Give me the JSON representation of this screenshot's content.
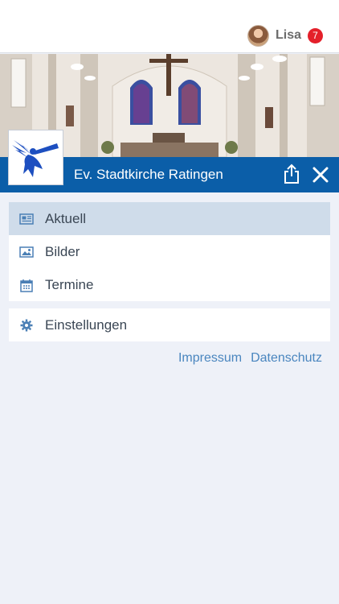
{
  "user": {
    "name": "Lisa",
    "notification_count": "7"
  },
  "header": {
    "title": "Ev. Stadtkirche Ratingen",
    "share_icon": "share-icon",
    "close_icon": "close-icon"
  },
  "menu": {
    "items": [
      {
        "label": "Aktuell",
        "icon": "newspaper-icon",
        "active": true
      },
      {
        "label": "Bilder",
        "icon": "image-icon",
        "active": false
      },
      {
        "label": "Termine",
        "icon": "calendar-icon",
        "active": false
      }
    ],
    "settings": {
      "label": "Einstellungen",
      "icon": "gear-icon"
    }
  },
  "footer": {
    "impressum": "Impressum",
    "datenschutz": "Datenschutz"
  },
  "colors": {
    "primary": "#0b5ea8",
    "active_row": "#cfdcea",
    "link": "#4a86bf",
    "badge": "#e4202a",
    "background": "#eef1f8"
  }
}
